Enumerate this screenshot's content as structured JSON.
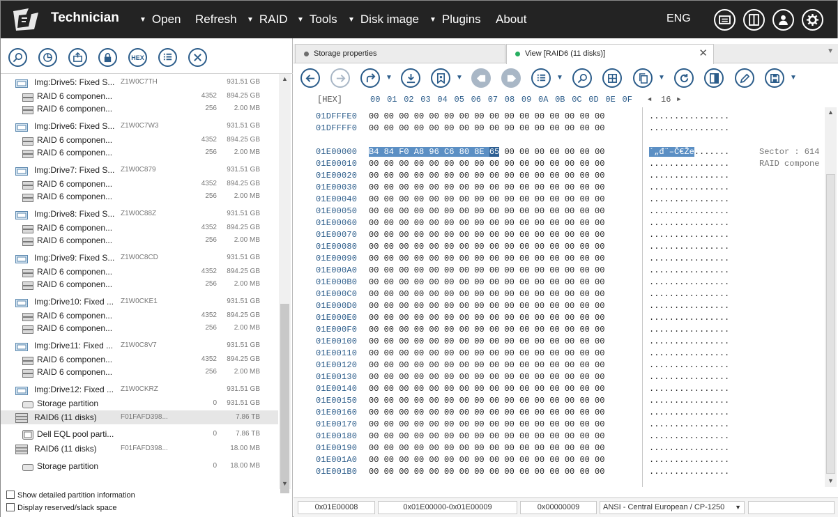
{
  "app": {
    "title": "Technician",
    "language": "ENG"
  },
  "menu": [
    {
      "label": "Open",
      "dropdown": true
    },
    {
      "label": "Refresh",
      "dropdown": false
    },
    {
      "label": "RAID",
      "dropdown": true
    },
    {
      "label": "Tools",
      "dropdown": true
    },
    {
      "label": "Disk image",
      "dropdown": true
    },
    {
      "label": "Plugins",
      "dropdown": true
    },
    {
      "label": "About",
      "dropdown": false
    }
  ],
  "left_toolbar": {
    "hex_label": "HEX"
  },
  "tree": [
    {
      "type": "disk",
      "name": "Img:Drive5: Fixed S...",
      "code": "Z1W0C7TH",
      "count": "",
      "size": "931.51 GB"
    },
    {
      "type": "comp",
      "name": "RAID 6 componen...",
      "code": "",
      "count": "4352",
      "size": "894.25 GB"
    },
    {
      "type": "comp",
      "name": "RAID 6 componen...",
      "code": "",
      "count": "256",
      "size": "2.00 MB"
    },
    {
      "type": "disk",
      "name": "Img:Drive6: Fixed S...",
      "code": "Z1W0C7W3",
      "count": "",
      "size": "931.51 GB"
    },
    {
      "type": "comp",
      "name": "RAID 6 componen...",
      "code": "",
      "count": "4352",
      "size": "894.25 GB"
    },
    {
      "type": "comp",
      "name": "RAID 6 componen...",
      "code": "",
      "count": "256",
      "size": "2.00 MB"
    },
    {
      "type": "disk",
      "name": "Img:Drive7: Fixed S...",
      "code": "Z1W0C879",
      "count": "",
      "size": "931.51 GB"
    },
    {
      "type": "comp",
      "name": "RAID 6 componen...",
      "code": "",
      "count": "4352",
      "size": "894.25 GB"
    },
    {
      "type": "comp",
      "name": "RAID 6 componen...",
      "code": "",
      "count": "256",
      "size": "2.00 MB"
    },
    {
      "type": "disk",
      "name": "Img:Drive8: Fixed S...",
      "code": "Z1W0C88Z",
      "count": "",
      "size": "931.51 GB"
    },
    {
      "type": "comp",
      "name": "RAID 6 componen...",
      "code": "",
      "count": "4352",
      "size": "894.25 GB"
    },
    {
      "type": "comp",
      "name": "RAID 6 componen...",
      "code": "",
      "count": "256",
      "size": "2.00 MB"
    },
    {
      "type": "disk",
      "name": "Img:Drive9: Fixed S...",
      "code": "Z1W0C8CD",
      "count": "",
      "size": "931.51 GB"
    },
    {
      "type": "comp",
      "name": "RAID 6 componen...",
      "code": "",
      "count": "4352",
      "size": "894.25 GB"
    },
    {
      "type": "comp",
      "name": "RAID 6 componen...",
      "code": "",
      "count": "256",
      "size": "2.00 MB"
    },
    {
      "type": "disk",
      "name": "Img:Drive10: Fixed ...",
      "code": "Z1W0CKE1",
      "count": "",
      "size": "931.51 GB"
    },
    {
      "type": "comp",
      "name": "RAID 6 componen...",
      "code": "",
      "count": "4352",
      "size": "894.25 GB"
    },
    {
      "type": "comp",
      "name": "RAID 6 componen...",
      "code": "",
      "count": "256",
      "size": "2.00 MB"
    },
    {
      "type": "disk",
      "name": "Img:Drive11: Fixed ...",
      "code": "Z1W0C8V7",
      "count": "",
      "size": "931.51 GB"
    },
    {
      "type": "comp",
      "name": "RAID 6 componen...",
      "code": "",
      "count": "4352",
      "size": "894.25 GB"
    },
    {
      "type": "comp",
      "name": "RAID 6 componen...",
      "code": "",
      "count": "256",
      "size": "2.00 MB"
    },
    {
      "type": "disk",
      "name": "Img:Drive12: Fixed ...",
      "code": "Z1W0CKRZ",
      "count": "",
      "size": "931.51 GB"
    },
    {
      "type": "part",
      "name": "Storage partition",
      "code": "",
      "count": "0",
      "size": "931.51 GB"
    },
    {
      "type": "raid",
      "name": "RAID6 (11 disks)",
      "code": "F01FAFD398...",
      "count": "",
      "size": "7.86 TB",
      "selected": true
    },
    {
      "type": "pool",
      "name": "Dell EQL pool parti...",
      "code": "",
      "count": "0",
      "size": "7.86 TB"
    },
    {
      "type": "raid",
      "name": "RAID6 (11 disks)",
      "code": "F01FAFD398...",
      "count": "",
      "size": "18.00 MB"
    },
    {
      "type": "part",
      "name": "Storage partition",
      "code": "",
      "count": "0",
      "size": "18.00 MB"
    }
  ],
  "options": {
    "show_detailed": "Show detailed partition information",
    "display_reserved": "Display reserved/slack space"
  },
  "tabs": [
    {
      "label": "Storage properties",
      "active": false,
      "dot_color": "#6e6e6e"
    },
    {
      "label": "View [RAID6 (11 disks)]",
      "active": true,
      "dot_color": "#27ae60"
    }
  ],
  "hex_header": {
    "mode": "[HEX]",
    "columns": [
      "00",
      "01",
      "02",
      "03",
      "04",
      "05",
      "06",
      "07",
      "08",
      "09",
      "0A",
      "0B",
      "0C",
      "0D",
      "0E",
      "0F"
    ],
    "width_label": "16"
  },
  "hex_rows": [
    {
      "offset": "01DFFFE0",
      "bytes": "00 00 00 00 00 00 00 00 00 00 00 00 00 00 00 00",
      "ascii": "................"
    },
    {
      "offset": "01DFFFF0",
      "bytes": "00 00 00 00 00 00 00 00 00 00 00 00 00 00 00 00",
      "ascii": "................"
    },
    {
      "offset": "01E00000",
      "hl_bytes": "B4 84 F0 A8 96 C6 80 8E",
      "cur_byte": "65",
      "rest_bytes": " 00 00 00 00 00 00 00",
      "hl_ascii": "´„đ¨–Č€Že",
      "ascii": ".......",
      "note": "Sector : 614"
    },
    {
      "offset": "01E00010",
      "bytes": "00 00 00 00 00 00 00 00 00 00 00 00 00 00 00 00",
      "ascii": "................",
      "note": "RAID compone"
    },
    {
      "offset": "01E00020",
      "bytes": "00 00 00 00 00 00 00 00 00 00 00 00 00 00 00 00",
      "ascii": "................"
    },
    {
      "offset": "01E00030",
      "bytes": "00 00 00 00 00 00 00 00 00 00 00 00 00 00 00 00",
      "ascii": "................"
    },
    {
      "offset": "01E00040",
      "bytes": "00 00 00 00 00 00 00 00 00 00 00 00 00 00 00 00",
      "ascii": "................"
    },
    {
      "offset": "01E00050",
      "bytes": "00 00 00 00 00 00 00 00 00 00 00 00 00 00 00 00",
      "ascii": "................"
    },
    {
      "offset": "01E00060",
      "bytes": "00 00 00 00 00 00 00 00 00 00 00 00 00 00 00 00",
      "ascii": "................"
    },
    {
      "offset": "01E00070",
      "bytes": "00 00 00 00 00 00 00 00 00 00 00 00 00 00 00 00",
      "ascii": "................"
    },
    {
      "offset": "01E00080",
      "bytes": "00 00 00 00 00 00 00 00 00 00 00 00 00 00 00 00",
      "ascii": "................"
    },
    {
      "offset": "01E00090",
      "bytes": "00 00 00 00 00 00 00 00 00 00 00 00 00 00 00 00",
      "ascii": "................"
    },
    {
      "offset": "01E000A0",
      "bytes": "00 00 00 00 00 00 00 00 00 00 00 00 00 00 00 00",
      "ascii": "................"
    },
    {
      "offset": "01E000B0",
      "bytes": "00 00 00 00 00 00 00 00 00 00 00 00 00 00 00 00",
      "ascii": "................"
    },
    {
      "offset": "01E000C0",
      "bytes": "00 00 00 00 00 00 00 00 00 00 00 00 00 00 00 00",
      "ascii": "................"
    },
    {
      "offset": "01E000D0",
      "bytes": "00 00 00 00 00 00 00 00 00 00 00 00 00 00 00 00",
      "ascii": "................"
    },
    {
      "offset": "01E000E0",
      "bytes": "00 00 00 00 00 00 00 00 00 00 00 00 00 00 00 00",
      "ascii": "................"
    },
    {
      "offset": "01E000F0",
      "bytes": "00 00 00 00 00 00 00 00 00 00 00 00 00 00 00 00",
      "ascii": "................"
    },
    {
      "offset": "01E00100",
      "bytes": "00 00 00 00 00 00 00 00 00 00 00 00 00 00 00 00",
      "ascii": "................"
    },
    {
      "offset": "01E00110",
      "bytes": "00 00 00 00 00 00 00 00 00 00 00 00 00 00 00 00",
      "ascii": "................"
    },
    {
      "offset": "01E00120",
      "bytes": "00 00 00 00 00 00 00 00 00 00 00 00 00 00 00 00",
      "ascii": "................"
    },
    {
      "offset": "01E00130",
      "bytes": "00 00 00 00 00 00 00 00 00 00 00 00 00 00 00 00",
      "ascii": "................"
    },
    {
      "offset": "01E00140",
      "bytes": "00 00 00 00 00 00 00 00 00 00 00 00 00 00 00 00",
      "ascii": "................"
    },
    {
      "offset": "01E00150",
      "bytes": "00 00 00 00 00 00 00 00 00 00 00 00 00 00 00 00",
      "ascii": "................"
    },
    {
      "offset": "01E00160",
      "bytes": "00 00 00 00 00 00 00 00 00 00 00 00 00 00 00 00",
      "ascii": "................"
    },
    {
      "offset": "01E00170",
      "bytes": "00 00 00 00 00 00 00 00 00 00 00 00 00 00 00 00",
      "ascii": "................"
    },
    {
      "offset": "01E00180",
      "bytes": "00 00 00 00 00 00 00 00 00 00 00 00 00 00 00 00",
      "ascii": "................"
    },
    {
      "offset": "01E00190",
      "bytes": "00 00 00 00 00 00 00 00 00 00 00 00 00 00 00 00",
      "ascii": "................"
    },
    {
      "offset": "01E001A0",
      "bytes": "00 00 00 00 00 00 00 00 00 00 00 00 00 00 00 00",
      "ascii": "................"
    },
    {
      "offset": "01E001B0",
      "bytes": "00 00 00 00 00 00 00 00 00 00 00 00 00 00 00 00",
      "ascii": "................"
    }
  ],
  "status": {
    "offset": "0x01E00008",
    "range": "0x01E00000-0x01E00009",
    "length": "0x00000009",
    "encoding": "ANSI - Central European / CP-1250"
  },
  "colors": {
    "menubar": "#232323",
    "accent": "#2b5c8a",
    "selection": "#5b8fc4"
  }
}
